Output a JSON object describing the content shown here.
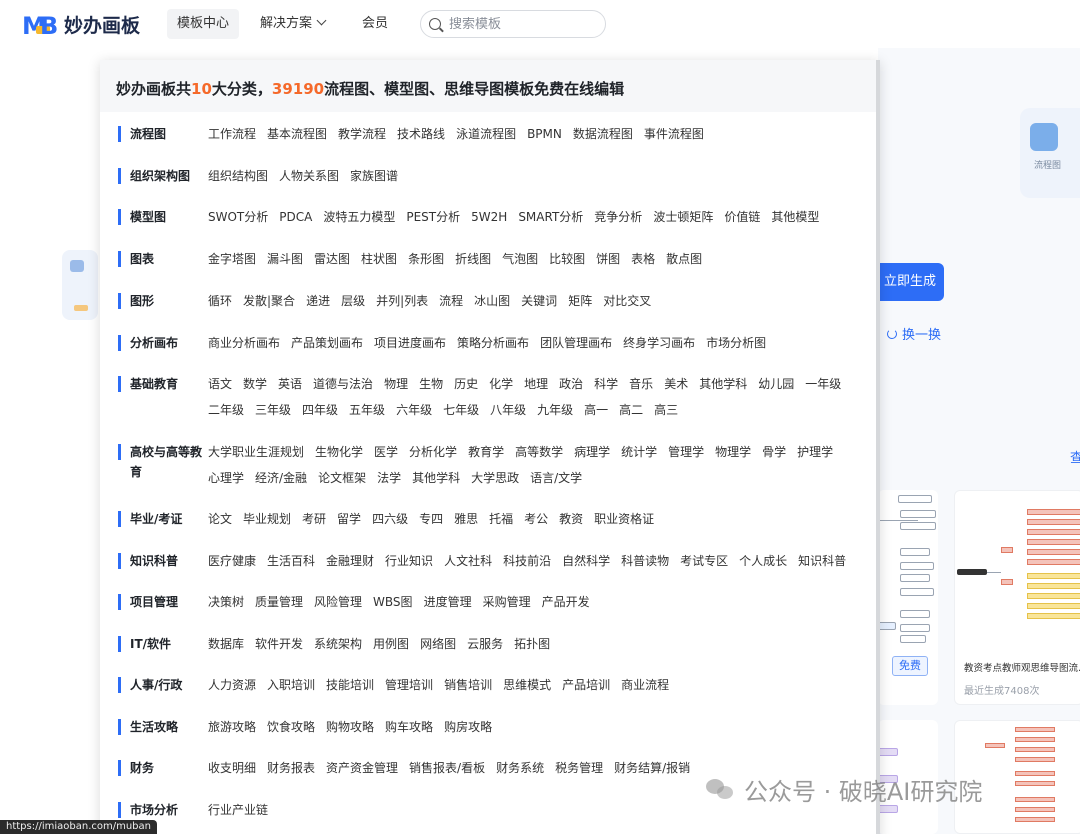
{
  "brand": {
    "name": "妙办画板",
    "mark_letters": "MB"
  },
  "nav": {
    "template_center": "模板中心",
    "solutions": "解决方案",
    "membership": "会员"
  },
  "search": {
    "placeholder": "搜索模板"
  },
  "panel": {
    "title_prefix": "妙办画板共",
    "category_count": "10",
    "title_mid": "大分类，",
    "template_count": "39190",
    "title_suffix": "流程图、模型图、思维导图模板免费在线编辑",
    "categories": [
      {
        "name": "流程图",
        "items": [
          "工作流程",
          "基本流程图",
          "教学流程",
          "技术路线",
          "泳道流程图",
          "BPMN",
          "数据流程图",
          "事件流程图"
        ]
      },
      {
        "name": "组织架构图",
        "items": [
          "组织结构图",
          "人物关系图",
          "家族图谱"
        ]
      },
      {
        "name": "模型图",
        "items": [
          "SWOT分析",
          "PDCA",
          "波特五力模型",
          "PEST分析",
          "5W2H",
          "SMART分析",
          "竞争分析",
          "波士顿矩阵",
          "价值链",
          "其他模型"
        ]
      },
      {
        "name": "图表",
        "items": [
          "金字塔图",
          "漏斗图",
          "雷达图",
          "柱状图",
          "条形图",
          "折线图",
          "气泡图",
          "比较图",
          "饼图",
          "表格",
          "散点图"
        ]
      },
      {
        "name": "图形",
        "items": [
          "循环",
          "发散|聚合",
          "递进",
          "层级",
          "并列|列表",
          "流程",
          "冰山图",
          "关键词",
          "矩阵",
          "对比交叉"
        ]
      },
      {
        "name": "分析画布",
        "items": [
          "商业分析画布",
          "产品策划画布",
          "项目进度画布",
          "策略分析画布",
          "团队管理画布",
          "终身学习画布",
          "市场分析图"
        ]
      },
      {
        "name": "基础教育",
        "items": [
          "语文",
          "数学",
          "英语",
          "道德与法治",
          "物理",
          "生物",
          "历史",
          "化学",
          "地理",
          "政治",
          "科学",
          "音乐",
          "美术",
          "其他学科",
          "幼儿园",
          "一年级",
          "二年级",
          "三年级",
          "四年级",
          "五年级",
          "六年级",
          "七年级",
          "八年级",
          "九年级",
          "高一",
          "高二",
          "高三"
        ]
      },
      {
        "name": "高校与高等教育",
        "items": [
          "大学职业生涯规划",
          "生物化学",
          "医学",
          "分析化学",
          "教育学",
          "高等数学",
          "病理学",
          "统计学",
          "管理学",
          "物理学",
          "骨学",
          "护理学",
          "心理学",
          "经济/金融",
          "论文框架",
          "法学",
          "其他学科",
          "大学思政",
          "语言/文学"
        ]
      },
      {
        "name": "毕业/考证",
        "items": [
          "论文",
          "毕业规划",
          "考研",
          "留学",
          "四六级",
          "专四",
          "雅思",
          "托福",
          "考公",
          "教资",
          "职业资格证"
        ]
      },
      {
        "name": "知识科普",
        "items": [
          "医疗健康",
          "生活百科",
          "金融理财",
          "行业知识",
          "人文社科",
          "科技前沿",
          "自然科学",
          "科普读物",
          "考试专区",
          "个人成长",
          "知识科普"
        ]
      },
      {
        "name": "项目管理",
        "items": [
          "决策树",
          "质量管理",
          "风险管理",
          "WBS图",
          "进度管理",
          "采购管理",
          "产品开发"
        ]
      },
      {
        "name": "IT/软件",
        "items": [
          "数据库",
          "软件开发",
          "系统架构",
          "用例图",
          "网络图",
          "云服务",
          "拓扑图"
        ]
      },
      {
        "name": "人事/行政",
        "items": [
          "人力资源",
          "入职培训",
          "技能培训",
          "管理培训",
          "销售培训",
          "思维模式",
          "产品培训",
          "商业流程"
        ]
      },
      {
        "name": "生活攻略",
        "items": [
          "旅游攻略",
          "饮食攻略",
          "购物攻略",
          "购车攻略",
          "购房攻略"
        ]
      },
      {
        "name": "财务",
        "items": [
          "收支明细",
          "财务报表",
          "资产资金管理",
          "销售报表/看板",
          "财务系统",
          "税务管理",
          "财务结算/报销"
        ]
      },
      {
        "name": "市场分析",
        "items": [
          "行业产业链"
        ]
      }
    ]
  },
  "background": {
    "deco_label": "流程图",
    "generate_button": "立即生成",
    "swap_label": "换一换",
    "view_link": "查",
    "free_badge": "免费",
    "card_title": "教资考点教师观思维导图流…",
    "card_meta": "最近生成7408次"
  },
  "watermark": "公众号 · 破晓AI研究院",
  "status_url": "https://imiaoban.com/muban",
  "colors": {
    "accent": "#2d6df6",
    "highlight": "#f5692a",
    "logo_yellow": "#f5b82e"
  }
}
